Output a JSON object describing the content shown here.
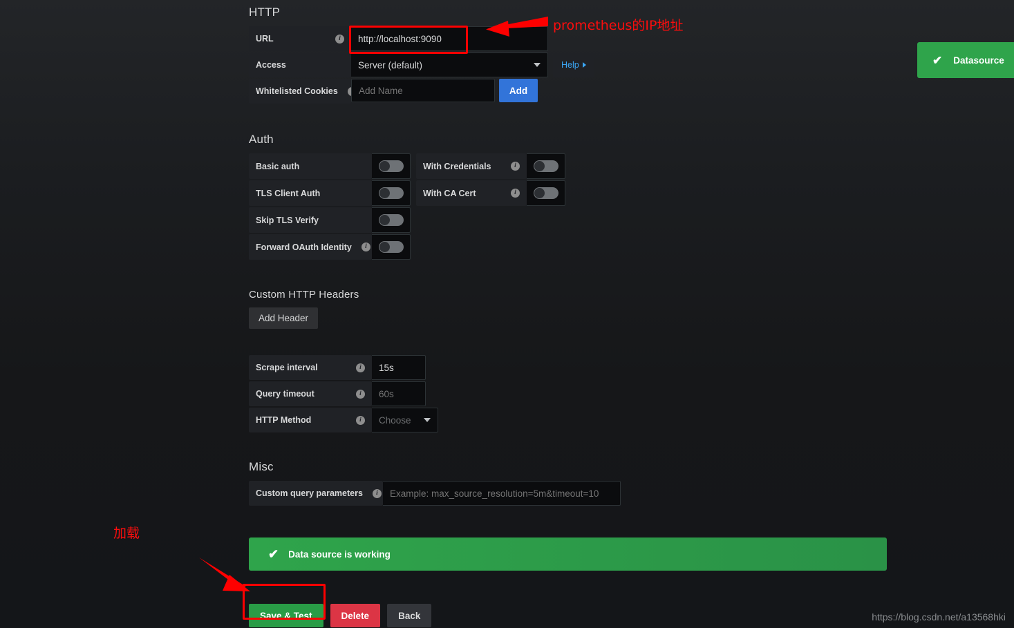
{
  "sections": {
    "http": {
      "title": "HTTP",
      "rows": {
        "url": {
          "label": "URL",
          "value": "http://localhost:9090"
        },
        "access": {
          "label": "Access",
          "value": "Server (default)",
          "help_label": "Help"
        },
        "cookies": {
          "label": "Whitelisted Cookies",
          "placeholder": "Add Name",
          "add_label": "Add"
        }
      }
    },
    "auth": {
      "title": "Auth",
      "toggles": [
        {
          "label": "Basic auth",
          "has_info": false,
          "state": "off"
        },
        {
          "label": "With Credentials",
          "has_info": true,
          "state": "off"
        },
        {
          "label": "TLS Client Auth",
          "has_info": false,
          "state": "off"
        },
        {
          "label": "With CA Cert",
          "has_info": true,
          "state": "off"
        },
        {
          "label": "Skip TLS Verify",
          "has_info": false,
          "state": "off"
        },
        {
          "label": "Forward OAuth Identity",
          "has_info": true,
          "state": "off"
        }
      ]
    },
    "headers": {
      "title": "Custom HTTP Headers",
      "add_header_label": "Add Header"
    },
    "intervals": {
      "scrape": {
        "label": "Scrape interval",
        "value": "15s"
      },
      "timeout": {
        "label": "Query timeout",
        "placeholder": "60s"
      },
      "method": {
        "label": "HTTP Method",
        "placeholder": "Choose"
      }
    },
    "misc": {
      "title": "Misc",
      "query_params": {
        "label": "Custom query parameters",
        "placeholder": "Example: max_source_resolution=5m&timeout=10"
      }
    }
  },
  "status_banner": {
    "icon": "check-icon",
    "message": "Data source is working",
    "color": "#2fa44b"
  },
  "actions": {
    "save_label": "Save & Test",
    "delete_label": "Delete",
    "back_label": "Back"
  },
  "toast": {
    "icon": "check-icon",
    "message": "Datasource",
    "color": "#2fa44b"
  },
  "annotations": {
    "url_note": "prometheus的IP地址",
    "save_note": "加载"
  },
  "watermark": "https://blog.csdn.net/a13568hki"
}
